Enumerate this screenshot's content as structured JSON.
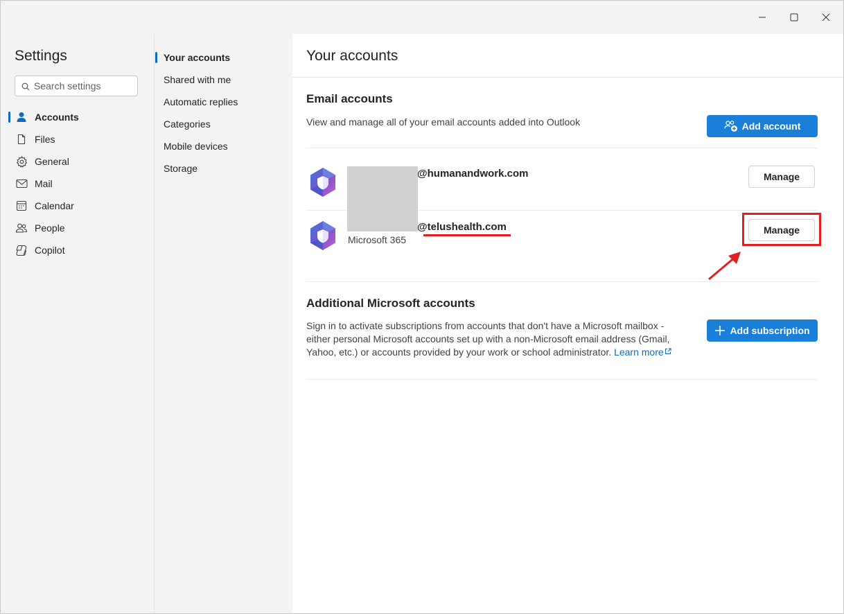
{
  "window": {
    "controls": {
      "minimize": "minimize-icon",
      "maximize": "maximize-icon",
      "close": "close-icon"
    }
  },
  "nav": {
    "title": "Settings",
    "search_placeholder": "Search settings",
    "items": [
      {
        "label": "Accounts",
        "icon": "person-icon",
        "active": true
      },
      {
        "label": "Files",
        "icon": "document-icon"
      },
      {
        "label": "General",
        "icon": "gear-icon"
      },
      {
        "label": "Mail",
        "icon": "mail-icon"
      },
      {
        "label": "Calendar",
        "icon": "calendar-icon"
      },
      {
        "label": "People",
        "icon": "people-icon"
      },
      {
        "label": "Copilot",
        "icon": "copilot-icon"
      }
    ]
  },
  "subnav": {
    "items": [
      {
        "label": "Your accounts",
        "active": true
      },
      {
        "label": "Shared with me"
      },
      {
        "label": "Automatic replies"
      },
      {
        "label": "Categories"
      },
      {
        "label": "Mobile devices"
      },
      {
        "label": "Storage"
      }
    ]
  },
  "content": {
    "title": "Your accounts",
    "email_section": {
      "title": "Email accounts",
      "description": "View and manage all of your email accounts added into Outlook",
      "add_button": "Add account",
      "accounts": [
        {
          "email": "@humanandwork.com",
          "subtitle": "",
          "manage_label": "Manage"
        },
        {
          "email": "@telushealth.com",
          "subtitle": "Microsoft 365",
          "manage_label": "Manage"
        }
      ]
    },
    "additional_section": {
      "title": "Additional Microsoft accounts",
      "description": "Sign in to activate subscriptions from accounts that don't have a Microsoft mailbox - either personal Microsoft accounts set up with a non-Microsoft email address (Gmail, Yahoo, etc.) or accounts provided by your work or school administrator.",
      "learn_more": "Learn more",
      "add_button": "Add subscription"
    }
  },
  "colors": {
    "accent": "#1a7fd9",
    "annotation": "#e02020"
  }
}
